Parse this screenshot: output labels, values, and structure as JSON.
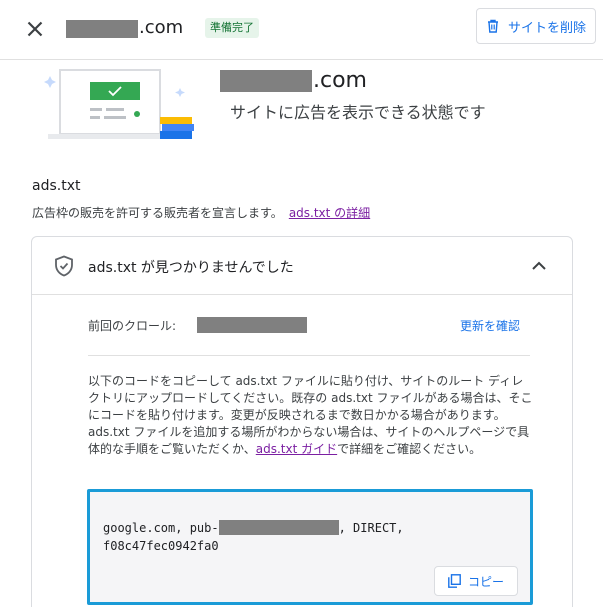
{
  "header": {
    "domain_suffix": ".com",
    "status_badge": "準備完了",
    "delete_label": "サイトを削除"
  },
  "hero": {
    "domain_suffix": ".com",
    "status_text": "サイトに広告を表示できる状態です"
  },
  "ads_section": {
    "title": "ads.txt",
    "description": "広告枠の販売を許可する販売者を宣言します。",
    "details_link": "ads.txt の詳細"
  },
  "card": {
    "title": "ads.txt が見つかりませんでした",
    "crawl_label": "前回のクロール:",
    "refresh_label": "更新を確認",
    "instructions_before": "以下のコードをコピーして ads.txt ファイルに貼り付け、サイトのルート ディレクトリにアップロードしてください。既存の ads.txt ファイルがある場合は、そこにコードを貼り付けます。変更が反映されるまで数日かかる場合があります。ads.txt ファイルを追加する場所がわからない場合は、サイトのヘルプページで具体的な手順をご覧いただくか、",
    "instructions_link": "ads.txt ガイド",
    "instructions_after": "で詳細をご確認ください。",
    "code_prefix": "google.com, pub-",
    "code_middle": ", DIRECT,",
    "code_line2": "f08c47fec0942fa0",
    "copy_label": "コピー"
  },
  "colors": {
    "accent_blue": "#1a73e8",
    "badge_green_bg": "#e6f4ea",
    "badge_green_text": "#137333",
    "link_purple": "#7b1fa2",
    "code_border": "#1a9bd7"
  },
  "icons": {
    "close": "close-icon",
    "delete": "trash-icon",
    "shield": "shield-icon",
    "collapse": "chevron-up-icon",
    "copy": "copy-icon"
  }
}
